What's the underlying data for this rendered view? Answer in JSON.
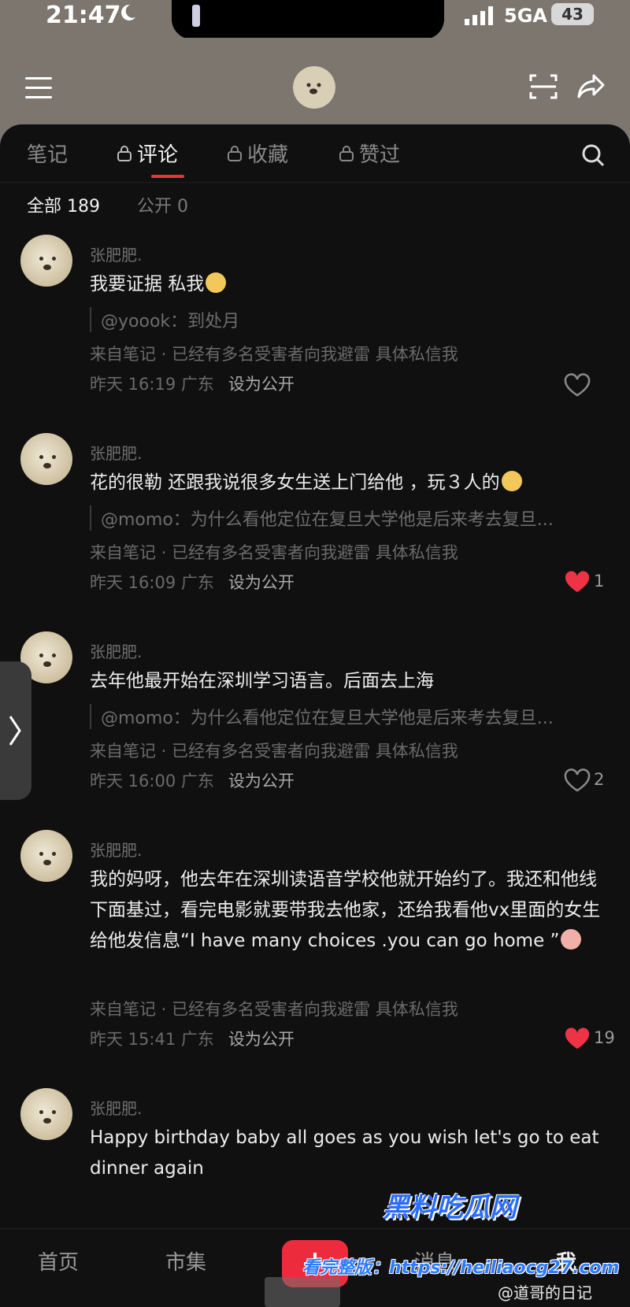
{
  "status": {
    "time": "21:47",
    "network": "5GA",
    "battery": "43"
  },
  "tabs": [
    {
      "label": "笔记",
      "locked": false
    },
    {
      "label": "评论",
      "locked": true,
      "active": true
    },
    {
      "label": "收藏",
      "locked": true
    },
    {
      "label": "赞过",
      "locked": true
    }
  ],
  "filters": {
    "all": "全部 189",
    "public": "公开 0"
  },
  "comments": [
    {
      "name": "张肥肥.",
      "text": "我要证据 私我",
      "quote": "@yoook：到处月",
      "from": "来自笔记 · 已经有多名受害者向我避雷 具体私信我",
      "time": "昨天 16:19 广东",
      "action": "设为公开",
      "likes": "",
      "liked": false
    },
    {
      "name": "张肥肥.",
      "text": "花的很勒 还跟我说很多女生送上门给他 ，玩３人的",
      "quote": "@momo：为什么看他定位在复旦大学他是后来考去复旦...",
      "from": "来自笔记 · 已经有多名受害者向我避雷 具体私信我",
      "time": "昨天 16:09 广东",
      "action": "设为公开",
      "likes": "1",
      "liked": true
    },
    {
      "name": "张肥肥.",
      "text": "去年他最开始在深圳学习语言。后面去上海",
      "quote": "@momo：为什么看他定位在复旦大学他是后来考去复旦...",
      "from": "来自笔记 · 已经有多名受害者向我避雷 具体私信我",
      "time": "昨天 16:00 广东",
      "action": "设为公开",
      "likes": "2",
      "liked": false
    },
    {
      "name": "张肥肥.",
      "text": "我的妈呀，他去年在深圳读语音学校他就开始约了。我还和他线下面基过，看完电影就要带我去他家，还给我看他vx里面的女生给他发信息“I have many choices .you can go home ”",
      "from": "来自笔记 · 已经有多名受害者向我避雷 具体私信我",
      "time": "昨天 15:41 广东",
      "action": "设为公开",
      "likes": "19",
      "liked": true
    },
    {
      "name": "张肥肥.",
      "text": "Happy birthday baby all goes as you wish let's go to eat dinner again"
    }
  ],
  "nav": {
    "home": "首页",
    "market": "市集",
    "messages": "消息",
    "me": "我"
  },
  "watermark": {
    "brand": "黑料吃瓜网",
    "url": "看完整版：https://heiliaocg27.com",
    "credit": "@道哥的日记"
  },
  "colors": {
    "accent": "#e8353c",
    "like_red": "#ee3347",
    "panel": "#101010",
    "header": "#7c766e"
  }
}
